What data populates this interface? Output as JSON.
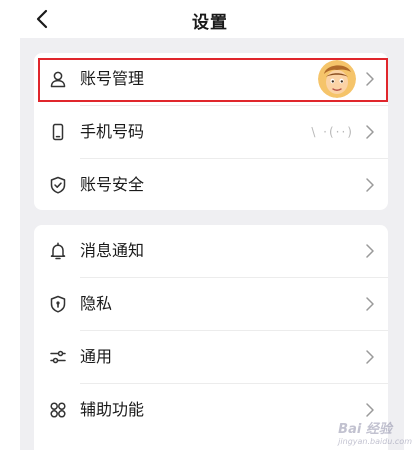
{
  "header": {
    "title": "设置"
  },
  "card1": {
    "items": [
      {
        "label": "账号管理",
        "icon": "person-icon"
      },
      {
        "label": "手机号码",
        "icon": "phone-icon",
        "value": "\\         ·(··)"
      },
      {
        "label": "账号安全",
        "icon": "shield-check-icon"
      }
    ]
  },
  "card2": {
    "items": [
      {
        "label": "消息通知",
        "icon": "bell-icon"
      },
      {
        "label": "隐私",
        "icon": "lock-shield-icon"
      },
      {
        "label": "通用",
        "icon": "sliders-icon"
      },
      {
        "label": "辅助功能",
        "icon": "grid-cluster-icon"
      }
    ]
  },
  "watermark": {
    "text": "Bai 经验",
    "sub": "jingyan.baidu.com"
  },
  "colors": {
    "highlight": "#e0262c",
    "background": "#efeff2"
  }
}
